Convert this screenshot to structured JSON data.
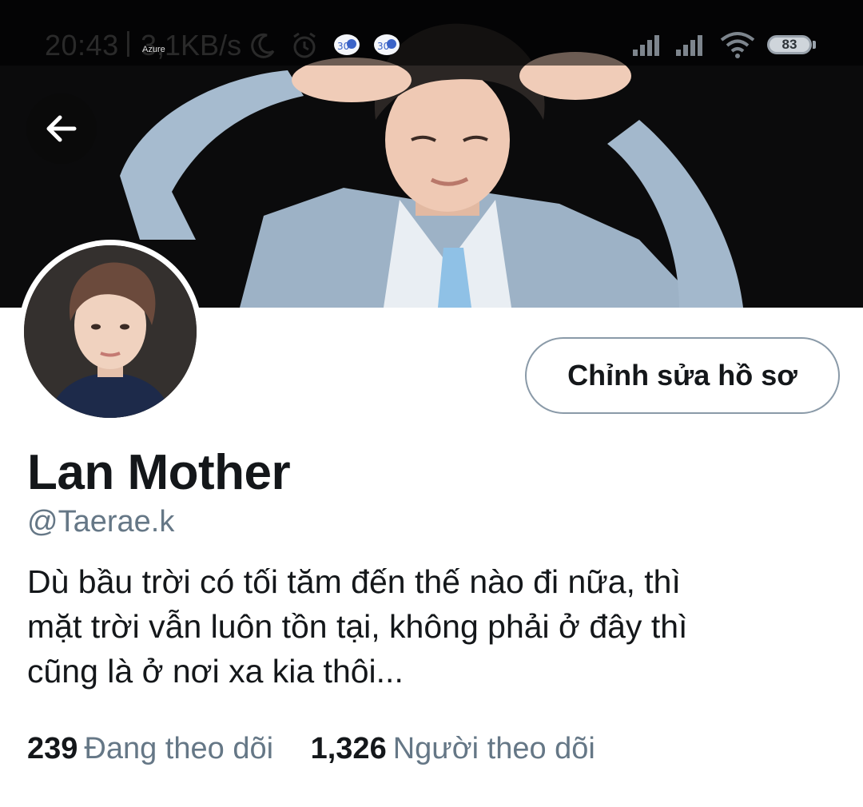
{
  "status_bar": {
    "time": "20:43",
    "separator": "|",
    "network_speed": "3,1KB/s",
    "carrier_label": "Azure",
    "battery_level": "83",
    "icons": [
      "moon-icon",
      "alarm-icon",
      "app-notification-icon",
      "app-notification-icon",
      "cellular-signal-icon",
      "cellular-signal-icon",
      "wifi-icon",
      "battery-icon"
    ]
  },
  "header": {
    "back_icon": "arrow-left-icon"
  },
  "profile": {
    "display_name": "Lan Mother",
    "handle": "@Taerae.k",
    "edit_button_label": "Chỉnh sửa hồ sơ",
    "bio_lines": [
      "Dù bầu trời có tối tăm đến thế nào đi nữa, thì",
      "mặt trời vẫn luôn tồn tại, không phải ở đây thì",
      "cũng là ở nơi xa kia thôi..."
    ],
    "following": {
      "count": "239",
      "label": "Đang theo dõi"
    },
    "followers": {
      "count": "1,326",
      "label": "Người theo dõi"
    }
  },
  "colors": {
    "primary_text": "#14171a",
    "secondary_text": "#657786",
    "button_border": "#8a9aa8",
    "banner_background": "#0b0b0c"
  }
}
